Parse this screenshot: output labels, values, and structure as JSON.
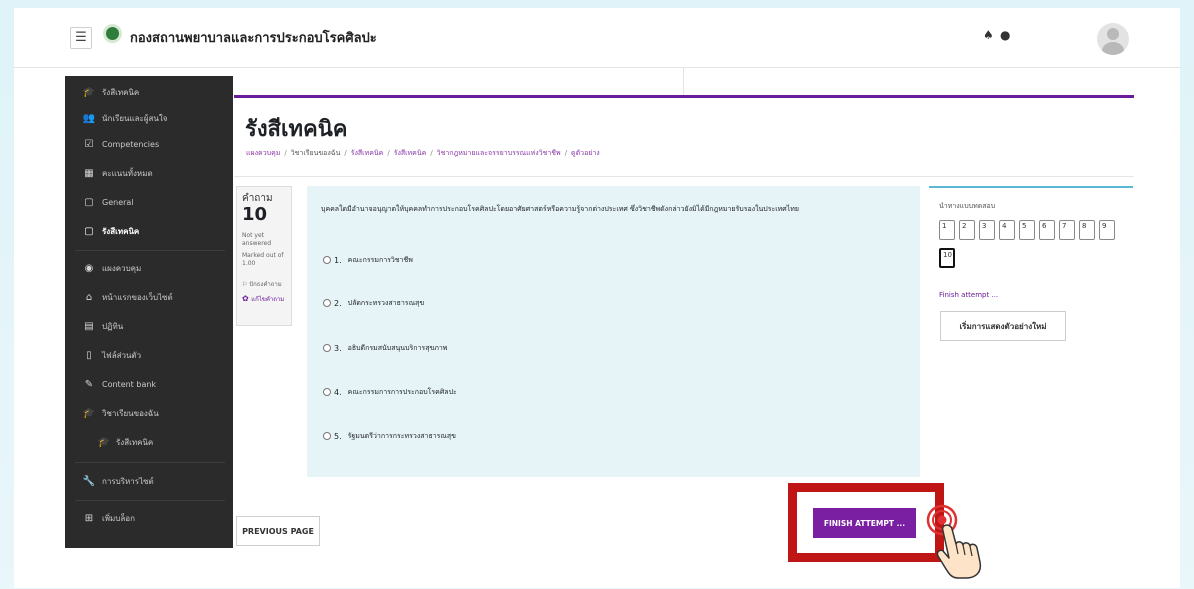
{
  "navbar": {
    "menu_icon": "☰",
    "site_name": "กองสถานพยาบาลและการประกอบโรคศิลปะ",
    "bell_icon": "♠",
    "chat_icon": "●"
  },
  "sidebar": {
    "items": [
      {
        "icon": "graduation-cap-icon",
        "glyph": "🎓",
        "label": "รังสีเทคนิค"
      },
      {
        "icon": "users-icon",
        "glyph": "👥",
        "label": "นักเรียนและผู้สนใจ"
      },
      {
        "icon": "checkbox-icon",
        "glyph": "☑",
        "label": "Competencies"
      },
      {
        "icon": "grid-icon",
        "glyph": "▦",
        "label": "คะแนนทั้งหมด"
      },
      {
        "icon": "folder-icon",
        "glyph": "▢",
        "label": "General"
      },
      {
        "icon": "folder-icon",
        "glyph": "▢",
        "label": "รังสีเทคนิค"
      },
      {
        "icon": "dashboard-icon",
        "glyph": "◉",
        "label": "แผงควบคุม"
      },
      {
        "icon": "home-icon",
        "glyph": "⌂",
        "label": "หน้าแรกของเว็บไซต์"
      },
      {
        "icon": "calendar-icon",
        "glyph": "▤",
        "label": "ปฏิทิน"
      },
      {
        "icon": "file-icon",
        "glyph": "▯",
        "label": "ไฟล์ส่วนตัว"
      },
      {
        "icon": "pencil-icon",
        "glyph": "✎",
        "label": "Content bank"
      },
      {
        "icon": "graduation-cap-icon",
        "glyph": "🎓",
        "label": "วิชาเรียนของฉัน"
      },
      {
        "icon": "graduation-cap-icon",
        "glyph": "🎓",
        "label": "รังสีเทคนิค"
      },
      {
        "icon": "wrench-icon",
        "glyph": "🔧",
        "label": "การบริหารไซต์"
      },
      {
        "icon": "plus-square-icon",
        "glyph": "⊞",
        "label": "เพิ่มบล็อก"
      }
    ]
  },
  "page": {
    "title": "รังสีเทคนิค",
    "breadcrumb": [
      "แผงควบคุม",
      "วิชาเรียนของฉัน",
      "รังสีเทคนิค",
      "รังสีเทคนิค",
      "วิชากฎหมายและจรรยาบรรณแห่งวิชาชีพ",
      "ดูตัวอย่าง"
    ]
  },
  "question_info": {
    "word": "คำถาม",
    "number": "10",
    "state": "Not yet answered",
    "grade": "Marked out of 1.00",
    "flag": "ปักธงคำถาม",
    "edit": "แก้ไขคำถาม"
  },
  "question": {
    "text": "บุคคลใดมีอำนาจอนุญาตให้บุคคลทำการประกอบโรคศิลปะโดยอาศัยศาสตร์หรือความรู้จากต่างประเทศ ซึ่งวิชาชีพดังกล่าวยังมิได้มีกฎหมายรับรองในประเทศไทย",
    "answers": [
      {
        "num": "1.",
        "text": "คณะกรรมการวิชาชีพ"
      },
      {
        "num": "2.",
        "text": "ปลัดกระทรวงสาธารณสุข"
      },
      {
        "num": "3.",
        "text": "อธิบดีกรมสนับสนุนบริการสุขภาพ"
      },
      {
        "num": "4.",
        "text": "คณะกรรมการการประกอบโรคศิลปะ"
      },
      {
        "num": "5.",
        "text": "รัฐมนตรีว่าการกระทรวงสาธารณสุข"
      }
    ]
  },
  "quiz_nav": {
    "title": "นำทางแบบทดสอบ",
    "buttons": [
      "1",
      "2",
      "3",
      "4",
      "5",
      "6",
      "7",
      "8",
      "9",
      "10"
    ],
    "current": "10",
    "finish_link": "Finish attempt ...",
    "restart": "เริ่มการแสดงตัวอย่างใหม่"
  },
  "footer": {
    "prev": "PREVIOUS PAGE",
    "finish": "FINISH ATTEMPT ..."
  },
  "colors": {
    "accent": "#7a1fa2",
    "highlight": "#c01515",
    "sidebar": "#2b2b2b",
    "question_bg": "#e6f4f8"
  }
}
